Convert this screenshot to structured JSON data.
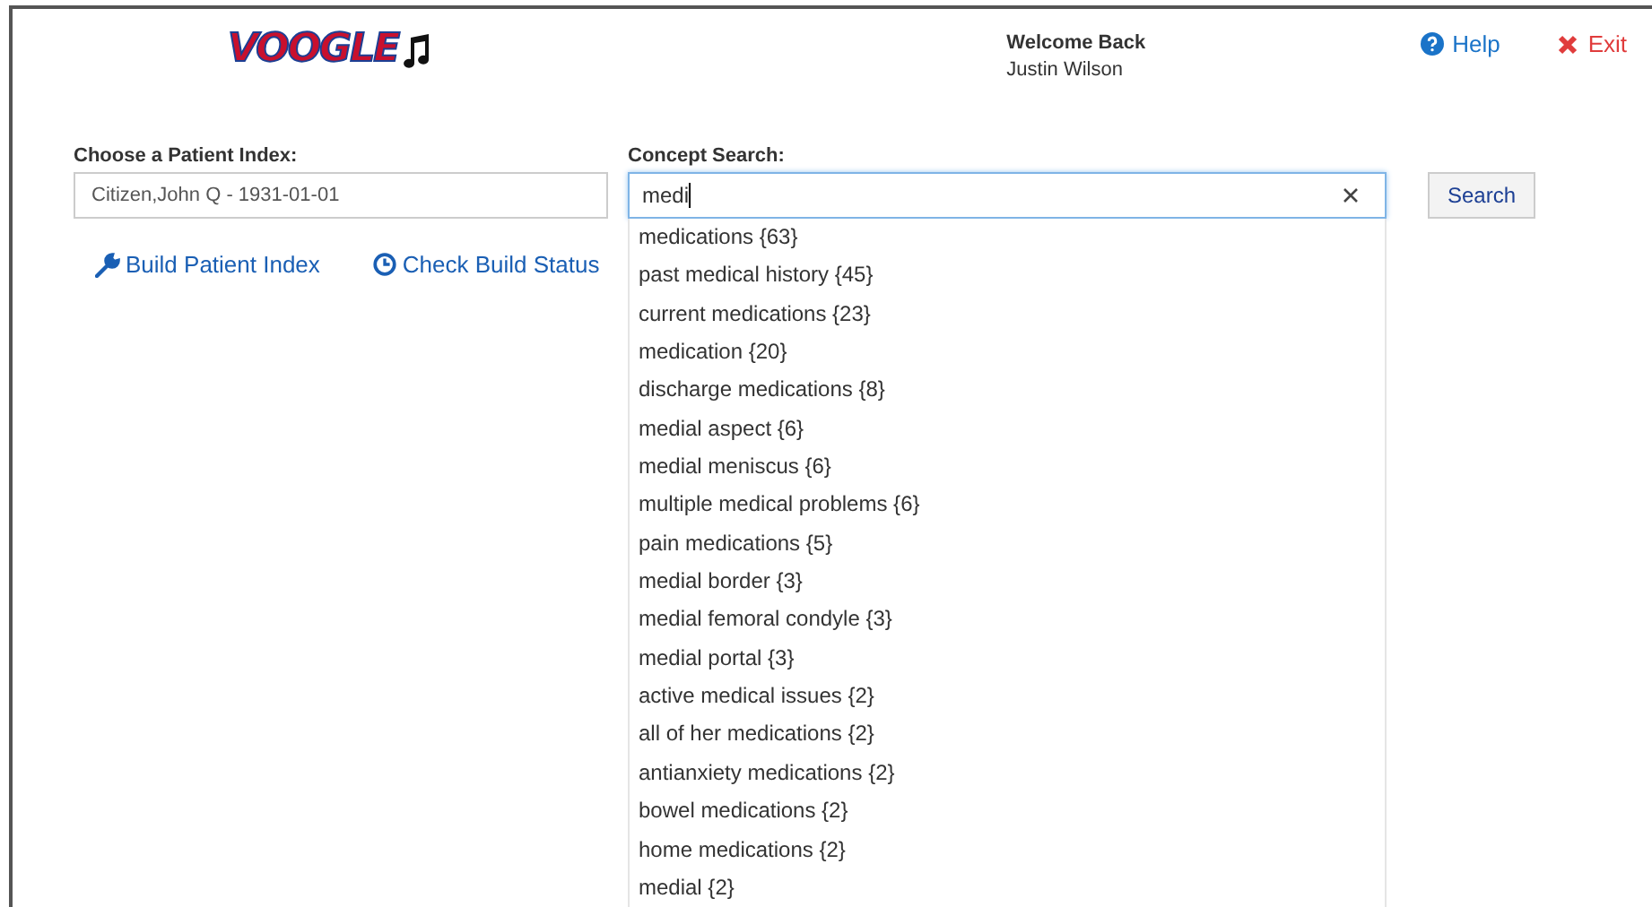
{
  "header": {
    "logo": "VOOGLE",
    "welcome": "Welcome Back",
    "user": "Justin Wilson",
    "links": [
      {
        "kind": "help",
        "label": "Help"
      },
      {
        "kind": "exit",
        "label": "Exit"
      }
    ]
  },
  "patient_index": {
    "label": "Choose a Patient Index:",
    "value": "Citizen,John Q - 1931-01-01"
  },
  "actions": [
    {
      "kind": "build",
      "label": "Build Patient Index"
    },
    {
      "kind": "status",
      "label": "Check Build Status"
    }
  ],
  "concept_search": {
    "label": "Concept Search:",
    "value": "medi",
    "focused": true,
    "button": "Search",
    "suggestions": [
      "medications {63}",
      "past medical history {45}",
      "current medications {23}",
      "medication {20}",
      "discharge medications {8}",
      "medial aspect {6}",
      "medial meniscus {6}",
      "multiple medical problems {6}",
      "pain medications {5}",
      "medial border {3}",
      "medial femoral condyle {3}",
      "medial portal {3}",
      "active medical issues {2}",
      "all of her medications {2}",
      "antianxiety medications {2}",
      "bowel medications {2}",
      "home medications {2}",
      "medial {2}"
    ]
  }
}
